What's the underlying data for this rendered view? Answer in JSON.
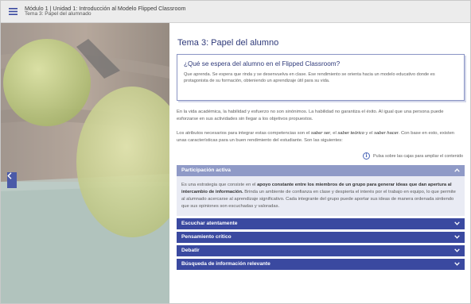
{
  "header": {
    "breadcrumb_line1": "Módulo 1 | Unidad 1: Introducción al Modelo Flipped Classroom",
    "breadcrumb_line2": "Tema 3: Papel del alumnado",
    "menu_icon": "hamburger-icon"
  },
  "nav": {
    "prev_icon": "chevron-left-icon"
  },
  "main": {
    "title": "Tema 3: Papel del alumno",
    "callout": {
      "title": "¿Qué se espera del alumno en el Flipped Classroom?",
      "text": "Que aprenda. Se espera que rinda y se desenvuelva en clase. Ese rendimiento se orienta hacia un modelo educativo donde es protagonista de su formación, obteniendo un aprendizaje útil para su vida."
    },
    "paragraph1": "En la vida académica, la habilidad y esfuerzo no son sinónimos. La habilidad no garantiza el éxito. Al igual que una persona puede esforzarse en sus actividades sin llegar a los objetivos propuestos.",
    "paragraph2": {
      "part1": "Los atributos necesarios para integrar estas competencias son el ",
      "em1": "saber ser",
      "part2": ", el ",
      "em2": "saber teórico",
      "part3": " y el ",
      "em3": "saber hacer",
      "part4": ". Con base en esto, existen unas características para un buen rendimiento del estudiante. Son las siguientes:"
    },
    "hint": {
      "icon": "info-icon",
      "text": "Pulsa sobre las cajas para ampliar el contenido"
    },
    "accordion": {
      "open_item": {
        "label": "Participación activa",
        "body_part1": "Es una estrategia que consiste en el ",
        "body_bold": "apoyo constante entre los miembros de un grupo para generar ideas que dan apertura al intercambio de información.",
        "body_part2": " Brinda un ambiente de confianza en clase y despierta el interés por el trabajo en equipo, lo que permite al alumnado acercarse al aprendizaje significativo. Cada integrante del grupo puede aportar sus ideas de manera ordenada sintiendo que sus opiniones son escuchadas y valoradas."
      },
      "items": [
        {
          "label": "Escuchar atentamente"
        },
        {
          "label": "Pensamiento crítico"
        },
        {
          "label": "Debatir"
        },
        {
          "label": "Búsqueda de información relevante"
        }
      ]
    }
  },
  "colors": {
    "accent_dark": "#3a49a0",
    "accent_light": "#8f9ac7",
    "title": "#2f3a7a"
  }
}
